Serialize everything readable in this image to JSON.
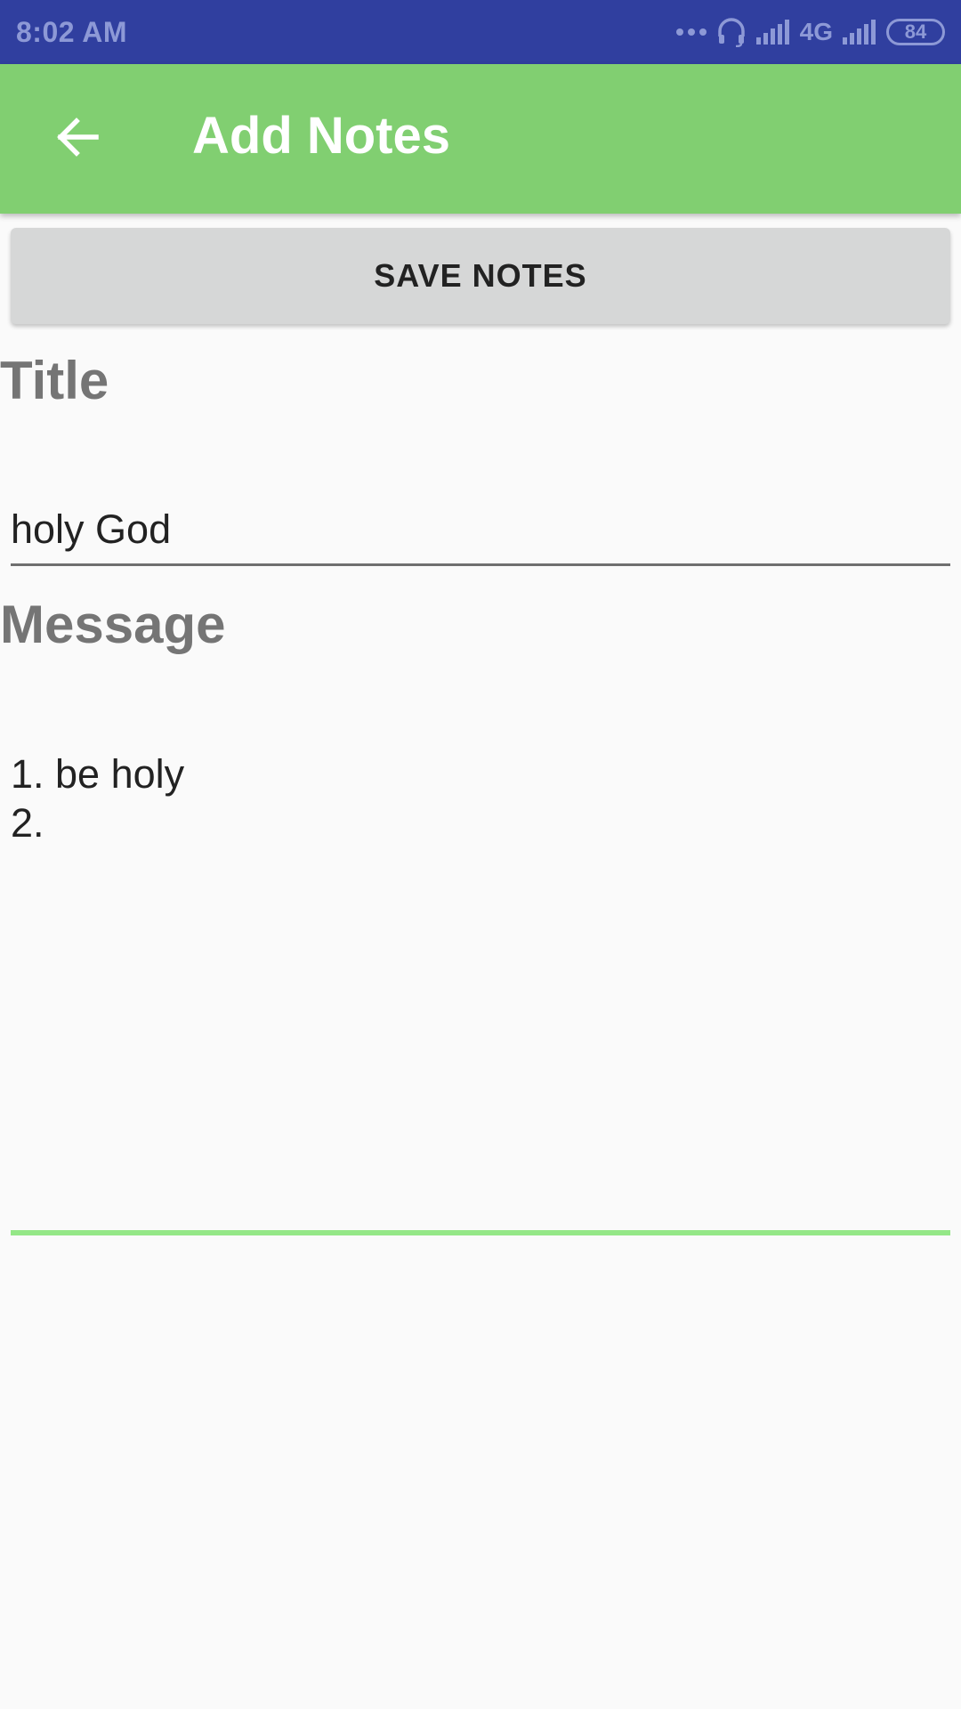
{
  "status_bar": {
    "time": "8:02 AM",
    "network_label": "4G",
    "battery": "84",
    "icons": [
      "more-dots-icon",
      "headset-icon",
      "signal-icon",
      "signal-icon"
    ],
    "color": "#303f9f"
  },
  "app_bar": {
    "title": "Add Notes",
    "back_icon": "arrow-back-icon",
    "color": "#81cf71"
  },
  "actions": {
    "save_label": "SAVE NOTES"
  },
  "form": {
    "title_label": "Title",
    "title_value": "holy God",
    "message_label": "Message",
    "message_lines": [
      "1. be holy",
      "2."
    ],
    "focus_color": "#94e787"
  }
}
